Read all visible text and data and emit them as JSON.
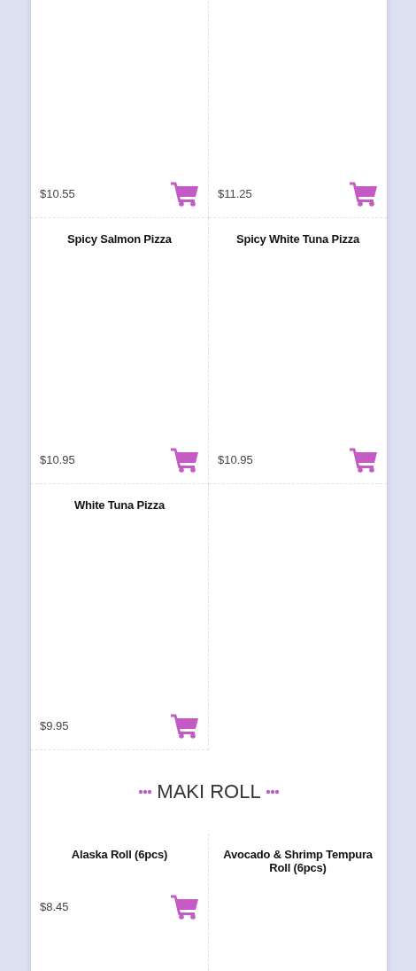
{
  "sections": [
    {
      "items": [
        {
          "price": "$10.55"
        },
        {
          "price": "$11.25"
        },
        {
          "name": "Spicy Salmon Pizza",
          "price": "$10.95"
        },
        {
          "name": "Spicy White Tuna Pizza",
          "price": "$10.95"
        },
        {
          "name": "White Tuna Pizza",
          "price": "$9.95"
        }
      ]
    },
    {
      "heading": "MAKI ROLL",
      "items": [
        {
          "name": "Alaska Roll (6pcs)",
          "price": "$8.45"
        },
        {
          "name": "Avocado & Shrimp Tempura Roll (6pcs)"
        }
      ]
    }
  ]
}
